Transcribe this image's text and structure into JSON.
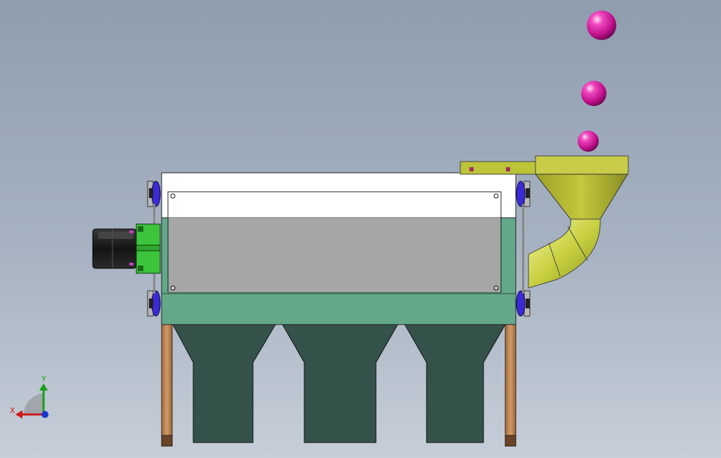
{
  "viewport": {
    "background_top": "#8f9daf",
    "background_bottom": "#c6ced8"
  },
  "triad": {
    "x_label": "X",
    "y_label": "Y",
    "x_color": "#d01818",
    "y_color": "#18a018",
    "z_color": "#1838d0"
  },
  "colors": {
    "body_top": "#ffffff",
    "panel": "#a6a6a6",
    "body_lower": "#64a88a",
    "hopper": "#34524a",
    "leg": "#c2875a",
    "motor": "#1c1c1c",
    "gearbox": "#3cc43c",
    "pulley": "#3a2bd6",
    "chute": "#bcc438",
    "ball": "#d01c9c"
  },
  "icons": {
    "triad": "coordinate-triad-icon",
    "balls": "sphere-icon"
  }
}
